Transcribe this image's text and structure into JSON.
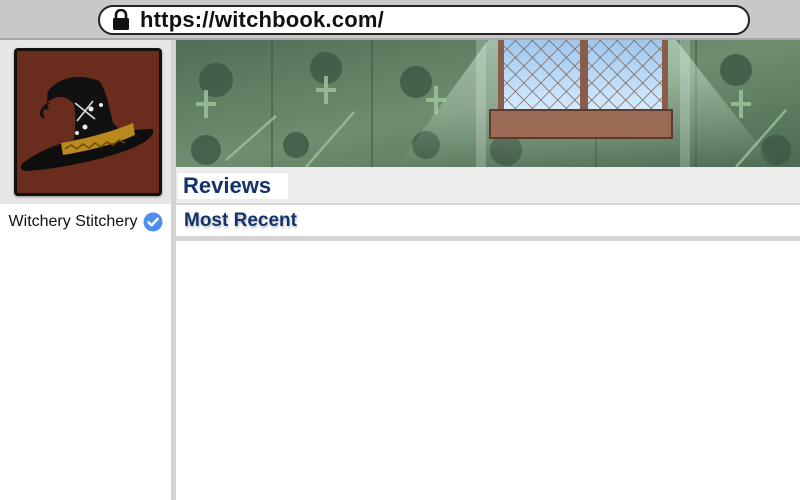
{
  "browser": {
    "url": "https://witchbook.com/",
    "lock_icon": "lock-icon"
  },
  "profile": {
    "name": "Witchery Stitchery",
    "verified": true,
    "avatar_icon": "witch-hat-icon",
    "avatar_background": "#6a2c1c"
  },
  "tabs": {
    "reviews_label": "Reviews"
  },
  "section": {
    "title": "Most Recent"
  },
  "colors": {
    "heading_blue": "#13336b",
    "verified_blue": "#4d8ef0",
    "banner_green": "#5a7a5e"
  },
  "reviews": []
}
